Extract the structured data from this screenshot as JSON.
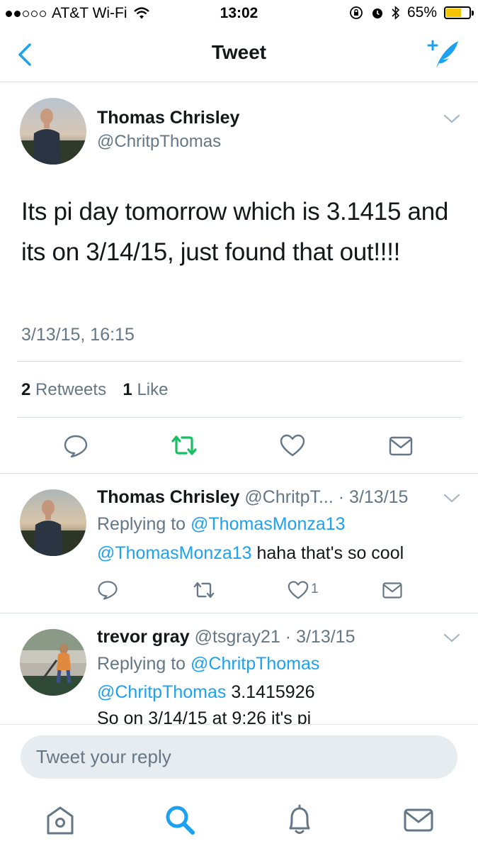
{
  "status_bar": {
    "carrier": "AT&T Wi-Fi",
    "time": "13:02",
    "battery": "65%",
    "battery_level": 0.65,
    "signal_bars_filled": 2,
    "signal_bars_total": 5
  },
  "nav": {
    "title": "Tweet",
    "back_icon": "chevron-left-icon",
    "compose_icon": "compose-tweet-icon",
    "accent_color": "#1da1f2"
  },
  "main_tweet": {
    "name": "Thomas Chrisley",
    "handle": "@ChritpThomas",
    "text": "Its pi day tomorrow which is 3.1415 and its on 3/14/15, just found that out!!!!",
    "timestamp": "3/13/15, 16:15",
    "retweet_count": "2",
    "retweet_label": "Retweets",
    "like_count": "1",
    "like_label": "Like",
    "retweet_color": "#17bf63"
  },
  "replies": [
    {
      "name": "Thomas Chrisley",
      "handle": "@ChritpT...",
      "date": "· 3/13/15",
      "replying_prefix": "Replying to",
      "replying_to": "@ThomasMonza13",
      "mention": "@ThomasMonza13",
      "text": " haha that's so cool",
      "like_count": "1"
    },
    {
      "name": "trevor gray",
      "handle": "@tsgray21",
      "date": "· 3/13/15",
      "replying_prefix": "Replying to",
      "replying_to": "@ChritpThomas",
      "mention": "@ChritpThomas",
      "text": " 3.1415926",
      "text_line2": "So on 3/14/15 at 9:26 it's pi"
    }
  ],
  "composer": {
    "placeholder": "Tweet your reply"
  },
  "tabbar": {
    "items": [
      "home-icon",
      "search-icon",
      "notifications-icon",
      "messages-icon"
    ],
    "active": "search-icon"
  }
}
